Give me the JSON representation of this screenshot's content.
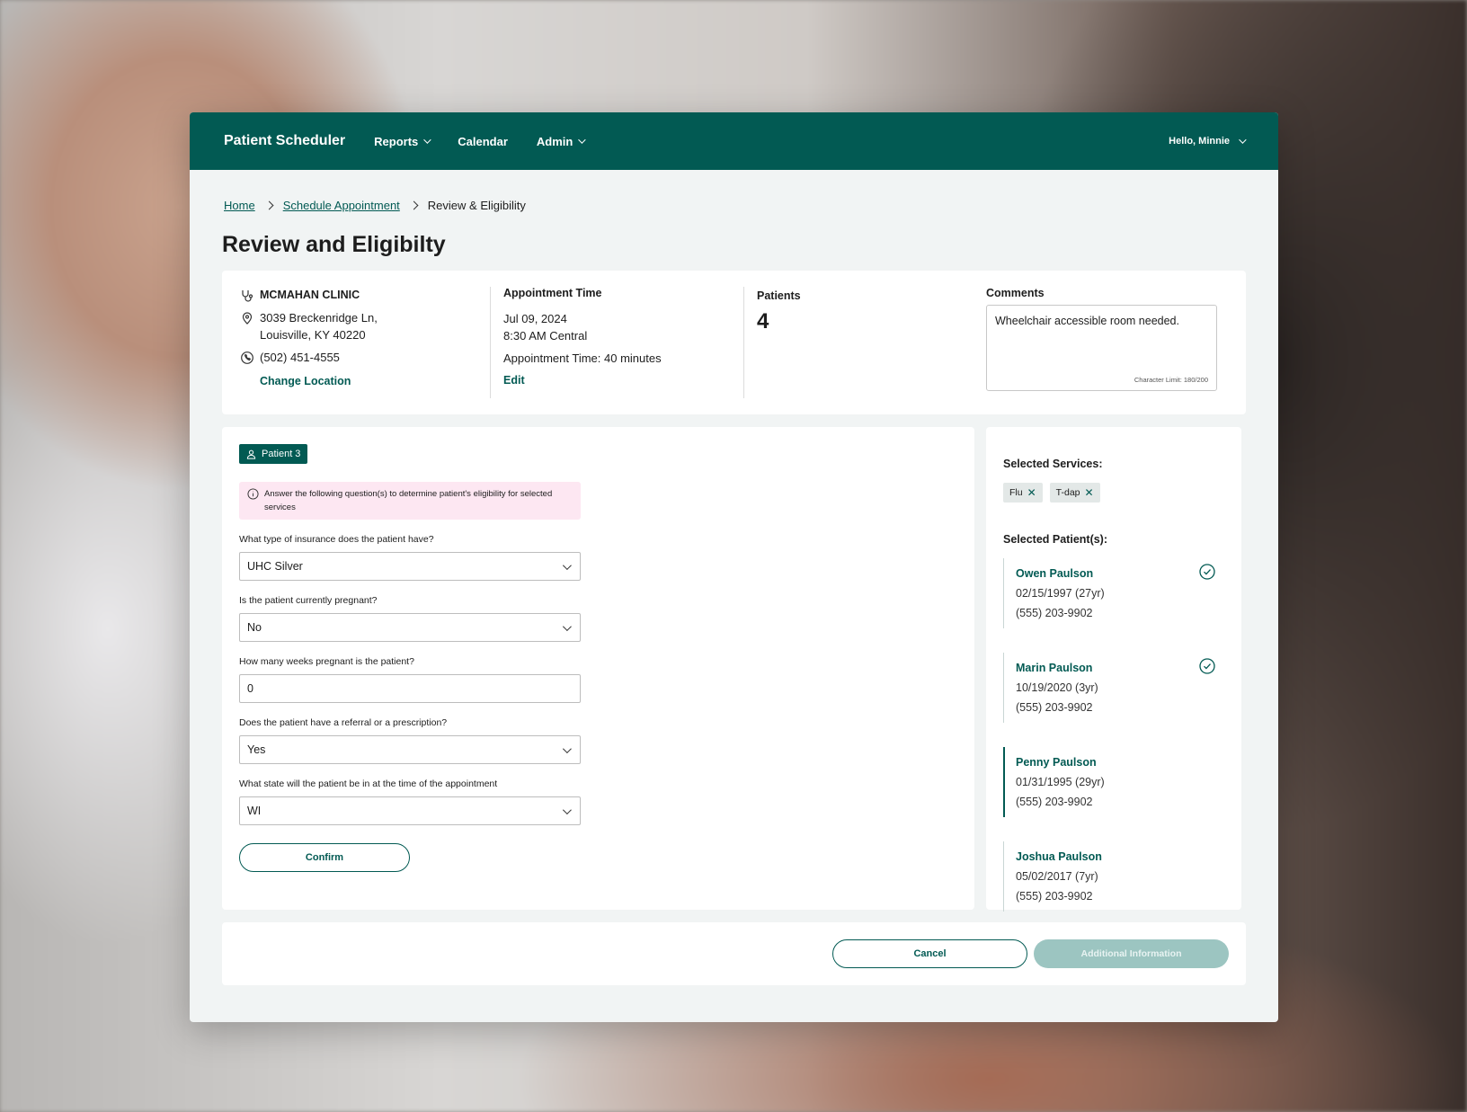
{
  "nav": {
    "brand": "Patient Scheduler",
    "items": [
      {
        "label": "Reports",
        "dropdown": true
      },
      {
        "label": "Calendar",
        "dropdown": false
      },
      {
        "label": "Admin",
        "dropdown": true
      }
    ],
    "user_greeting": "Hello, Minnie"
  },
  "breadcrumb": {
    "home": "Home",
    "schedule": "Schedule Appointment",
    "current": "Review & Eligibility"
  },
  "page_title": "Review and Eligibilty",
  "summary": {
    "clinic_name": "MCMAHAN CLINIC",
    "address_line1": "3039 Breckenridge Ln,",
    "address_line2": "Louisville, KY 40220",
    "phone": "(502) 451-4555",
    "change_location": "Change Location",
    "appointment_label": "Appointment Time",
    "date": "Jul 09, 2024",
    "time": "8:30 AM Central",
    "duration": "Appointment Time: 40 minutes",
    "edit": "Edit",
    "patients_label": "Patients",
    "patients_count": "4",
    "comments_label": "Comments",
    "comments_text": "Wheelchair accessible room needed.",
    "char_limit": "Character Limit: 180/200"
  },
  "form": {
    "patient_tag": "Patient 3",
    "info_text": "Answer the following question(s) to determine patient's eligibility for selected services",
    "questions": [
      {
        "label": "What type of insurance does the patient have?",
        "value": "UHC Silver",
        "type": "select"
      },
      {
        "label": "Is the patient currently pregnant?",
        "value": "No",
        "type": "select"
      },
      {
        "label": "How many weeks pregnant is the patient?",
        "value": "0",
        "type": "input"
      },
      {
        "label": "Does the patient have a referral or a prescription?",
        "value": "Yes",
        "type": "select"
      },
      {
        "label": "What state will the patient be in at the time of the appointment",
        "value": "WI",
        "type": "select"
      }
    ],
    "confirm": "Confirm"
  },
  "side": {
    "services_title": "Selected Services:",
    "services": [
      "Flu",
      "T-dap"
    ],
    "patients_title": "Selected Patient(s):",
    "patients": [
      {
        "name": "Owen Paulson",
        "dob": "02/15/1997 (27yr)",
        "phone": "(555) 203-9902",
        "checked": true
      },
      {
        "name": "Marin Paulson",
        "dob": "10/19/2020 (3yr)",
        "phone": "(555) 203-9902",
        "checked": true
      },
      {
        "name": "Penny Paulson",
        "dob": "01/31/1995 (29yr)",
        "phone": "(555) 203-9902",
        "checked": false
      },
      {
        "name": "Joshua Paulson",
        "dob": "05/02/2017 (7yr)",
        "phone": "(555) 203-9902",
        "checked": false
      }
    ]
  },
  "footer": {
    "cancel": "Cancel",
    "additional": "Additional Information"
  },
  "colors": {
    "brand": "#025a53",
    "info_bg": "#fde7f2",
    "disabled": "#9cc5c1"
  }
}
